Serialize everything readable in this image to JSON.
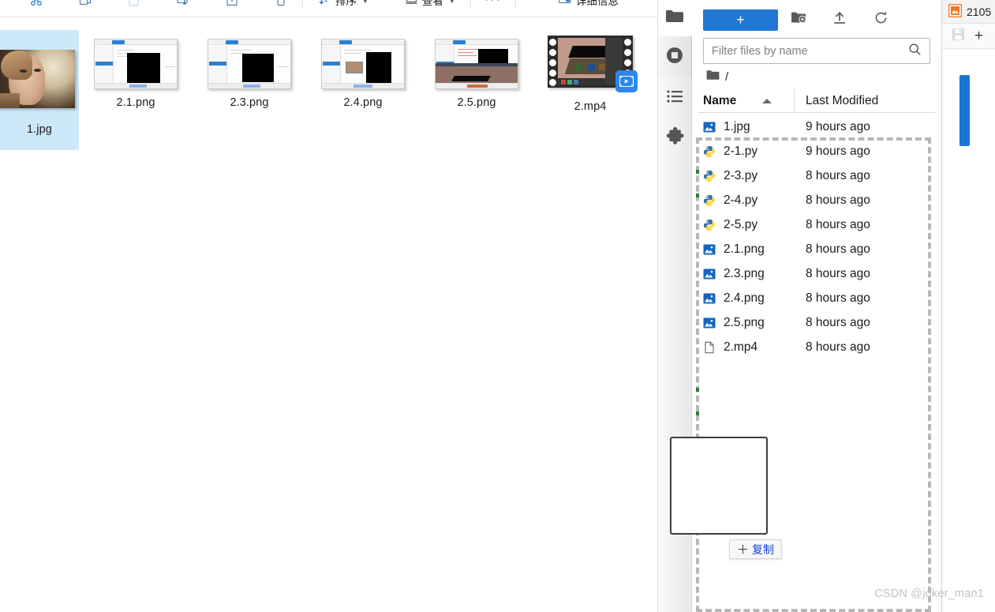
{
  "explorer": {
    "toolbar": {
      "icon_buttons": [
        {
          "name": "cut-icon",
          "label": "剪切"
        },
        {
          "name": "copy-icon",
          "label": "复制"
        },
        {
          "name": "paste-icon",
          "label": "粘贴"
        },
        {
          "name": "rename-icon",
          "label": "重命名"
        },
        {
          "name": "share-icon",
          "label": "共享"
        },
        {
          "name": "delete-icon",
          "label": "删除"
        }
      ],
      "sort_label": "排序",
      "view_label": "查看",
      "overflow_label": "···",
      "details_label": "详细信息"
    },
    "items": [
      {
        "name": "1.jpg",
        "kind": "photo",
        "selected": true
      },
      {
        "name": "2.1.png",
        "kind": "screenshot-terminal",
        "selected": false
      },
      {
        "name": "2.3.png",
        "kind": "screenshot-terminal",
        "selected": false
      },
      {
        "name": "2.4.png",
        "kind": "screenshot-photo",
        "selected": false
      },
      {
        "name": "2.5.png",
        "kind": "screenshot-3d",
        "selected": false
      },
      {
        "name": "2.mp4",
        "kind": "video",
        "selected": false
      }
    ]
  },
  "jupyter": {
    "sidebar": [
      {
        "name": "file-browser-icon",
        "label": "File Browser",
        "active": true
      },
      {
        "name": "running-terminals-icon",
        "label": "Running Terminals and Kernels",
        "active": false
      },
      {
        "name": "commands-list-icon",
        "label": "Commands",
        "active": false
      },
      {
        "name": "extension-manager-icon",
        "label": "Extension Manager",
        "active": false
      }
    ],
    "toolbar": {
      "new_launcher_label": "+",
      "new_folder_label": "New Folder",
      "upload_label": "Upload",
      "refresh_label": "Refresh"
    },
    "filter": {
      "value": "",
      "placeholder": "Filter files by name"
    },
    "breadcrumb": {
      "root_label": "/"
    },
    "columns": {
      "name": "Name",
      "last_modified": "Last Modified"
    },
    "sort": {
      "column": "Name",
      "direction": "ascending"
    },
    "files": [
      {
        "name": "1.jpg",
        "modified": "9 hours ago",
        "icon": "image-file-icon"
      },
      {
        "name": "2-1.py",
        "modified": "9 hours ago",
        "icon": "python-file-icon"
      },
      {
        "name": "2-3.py",
        "modified": "8 hours ago",
        "icon": "python-file-icon"
      },
      {
        "name": "2-4.py",
        "modified": "8 hours ago",
        "icon": "python-file-icon"
      },
      {
        "name": "2-5.py",
        "modified": "8 hours ago",
        "icon": "python-file-icon"
      },
      {
        "name": "2.1.png",
        "modified": "8 hours ago",
        "icon": "image-file-icon"
      },
      {
        "name": "2.3.png",
        "modified": "8 hours ago",
        "icon": "image-file-icon"
      },
      {
        "name": "2.4.png",
        "modified": "8 hours ago",
        "icon": "image-file-icon"
      },
      {
        "name": "2.5.png",
        "modified": "8 hours ago",
        "icon": "image-file-icon"
      },
      {
        "name": "2.mp4",
        "modified": "8 hours ago",
        "icon": "generic-file-icon"
      }
    ],
    "drag": {
      "plus": "＋",
      "action_label": "复制"
    }
  },
  "right_window": {
    "title": "2105",
    "save_label": "保存",
    "add_label": "+"
  },
  "watermark": "CSDN @joker_man1",
  "colors": {
    "accent_blue": "#2077d4",
    "selection_blue": "#cde8fa",
    "python_blue": "#3572A5",
    "image_icon_blue": "#1565c0",
    "drop_border": "#b8b8b8",
    "drag_link_blue": "#1a3fd6"
  }
}
